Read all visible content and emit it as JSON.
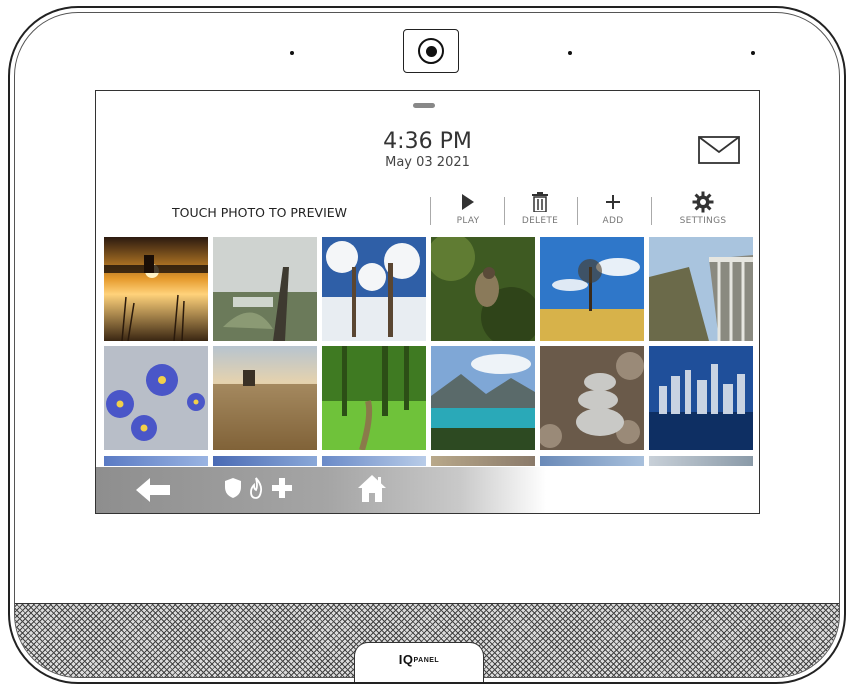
{
  "header": {
    "time": "4:36 PM",
    "date": "May 03 2021"
  },
  "photos": {
    "prompt": "TOUCH PHOTO TO PREVIEW"
  },
  "toolbar": {
    "play_label": "PLAY",
    "delete_label": "DELETE",
    "add_label": "ADD",
    "settings_label": "SETTINGS"
  },
  "icons": {
    "mail": "envelope-icon",
    "play": "play-icon",
    "delete": "trash-icon",
    "add": "plus-icon",
    "settings": "gear-icon",
    "back": "back-arrow-icon",
    "security": "shield-icon",
    "fire": "flame-icon",
    "medical": "medical-cross-icon",
    "home": "home-icon"
  },
  "device": {
    "logo_main": "IQ",
    "logo_sub": "PANEL"
  },
  "colors": {
    "navbar_gray": "#9a9a9a",
    "text": "#333333"
  }
}
